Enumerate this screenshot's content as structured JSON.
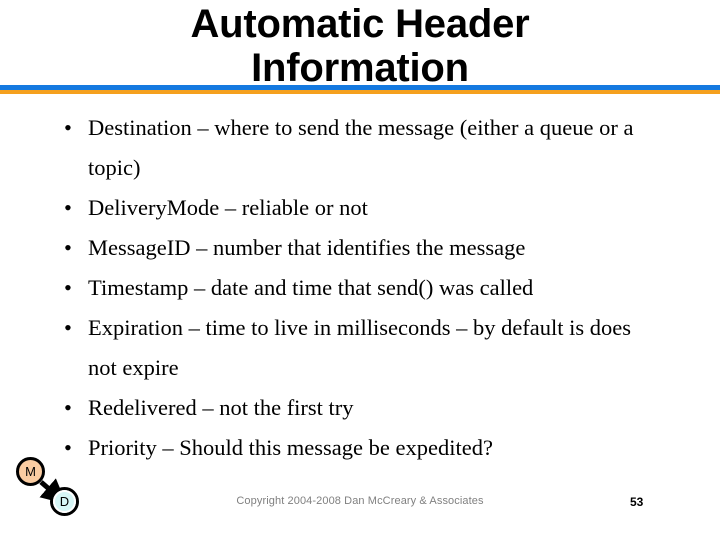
{
  "slide": {
    "title": "Automatic Header\nInformation",
    "divider": {
      "blue_color": "#1479e0",
      "orange_color": "#f5a01e"
    },
    "bullets": [
      {
        "marker": "•",
        "text": "Destination – where to send the message (either a queue or a topic)"
      },
      {
        "marker": "•",
        "text": "DeliveryMode – reliable or not"
      },
      {
        "marker": "•",
        "text": "MessageID – number that identifies the message"
      },
      {
        "marker": "•",
        "text": "Timestamp – date and time that send() was called"
      },
      {
        "marker": "•",
        "text": "Expiration – time to live in milliseconds – by default is does not expire"
      },
      {
        "marker": "•",
        "text": "Redelivered – not the first try"
      },
      {
        "marker": "•",
        "text": "Priority – Should this message be expedited?"
      }
    ],
    "footer": {
      "copyright": "Copyright 2004-2008 Dan McCreary & Associates",
      "page_number": "53"
    },
    "logo": {
      "node_m_label": "M",
      "node_d_label": "D",
      "node_m_color": "#fbcda2",
      "node_d_color": "#d6f6f6",
      "arrow_color": "#000000"
    }
  }
}
